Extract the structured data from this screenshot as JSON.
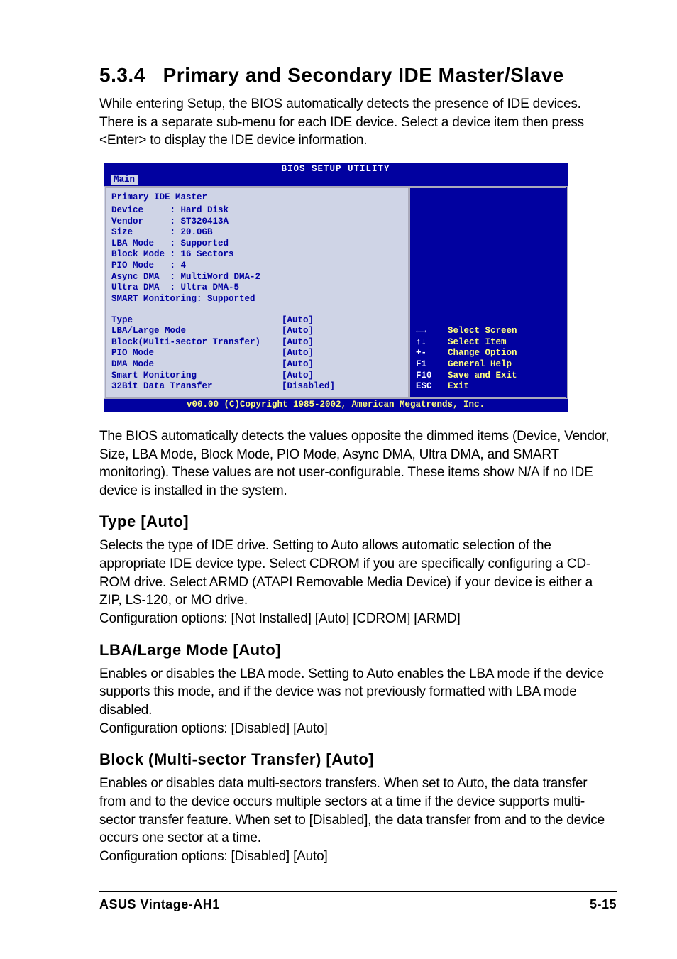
{
  "section": {
    "number": "5.3.4",
    "title": "Primary and Secondary IDE Master/Slave",
    "intro": "While entering Setup, the BIOS automatically detects the presence of IDE devices. There is a separate sub-menu for each IDE device. Select a device item then press <Enter> to display the IDE device information."
  },
  "bios": {
    "title": "BIOS SETUP UTILITY",
    "tab": "Main",
    "heading": "Primary IDE Master",
    "info": [
      {
        "label": "Device",
        "value": "Hard Disk"
      },
      {
        "label": "Vendor",
        "value": "ST320413A"
      },
      {
        "label": "Size",
        "value": "20.0GB"
      },
      {
        "label": "LBA Mode",
        "value": "Supported"
      },
      {
        "label": "Block Mode",
        "value": "16 Sectors"
      },
      {
        "label": "PIO Mode",
        "value": "4"
      },
      {
        "label": "Async DMA",
        "value": "MultiWord DMA-2"
      },
      {
        "label": "Ultra DMA",
        "value": "Ultra DMA-5"
      },
      {
        "label": "SMART Monitoring",
        "value": "Supported"
      }
    ],
    "options": [
      {
        "label": "Type",
        "value": "[Auto]"
      },
      {
        "label": "LBA/Large Mode",
        "value": "[Auto]"
      },
      {
        "label": "Block(Multi-sector Transfer)",
        "value": "[Auto]"
      },
      {
        "label": "PIO Mode",
        "value": "[Auto]"
      },
      {
        "label": "DMA Mode",
        "value": "[Auto]"
      },
      {
        "label": "Smart Monitoring",
        "value": "[Auto]"
      },
      {
        "label": "32Bit Data Transfer",
        "value": "[Disabled]"
      }
    ],
    "nav": [
      {
        "key": "←→",
        "label": "Select Screen"
      },
      {
        "key": "↑↓",
        "label": "Select Item"
      },
      {
        "key": "+-",
        "label": "Change Option"
      },
      {
        "key": "F1",
        "label": "General Help"
      },
      {
        "key": "F10",
        "label": "Save and Exit"
      },
      {
        "key": "ESC",
        "label": "Exit"
      }
    ],
    "footer": "v00.00 (C)Copyright 1985-2002, American Megatrends, Inc."
  },
  "after_bios": "The BIOS automatically detects the values opposite the dimmed items (Device, Vendor, Size, LBA Mode, Block Mode, PIO Mode, Async DMA, Ultra DMA, and SMART monitoring). These values are not user-configurable. These items show N/A if no IDE device is installed in the system.",
  "type_heading": "Type [Auto]",
  "type_body": "Selects the type of IDE drive. Setting to Auto allows automatic selection of the appropriate IDE device type. Select CDROM if you are specifically configuring a CD-ROM drive. Select ARMD (ATAPI Removable Media Device) if your device is either a ZIP, LS-120, or MO drive.\nConfiguration options: [Not Installed] [Auto] [CDROM] [ARMD]",
  "lba_heading": "LBA/Large Mode [Auto]",
  "lba_body": "Enables or disables the LBA mode. Setting to Auto enables the LBA mode if the device supports this mode, and if the device was not previously formatted with LBA mode disabled.\nConfiguration options: [Disabled] [Auto]",
  "block_heading": "Block (Multi-sector Transfer) [Auto]",
  "block_body": "Enables or disables data multi-sectors transfers. When set to Auto, the data transfer from and to the device occurs multiple sectors at a time if the device supports multi-sector transfer feature. When set to [Disabled], the data transfer from and to the device occurs one sector at a time.\nConfiguration options: [Disabled] [Auto]",
  "footer": {
    "left": "ASUS Vintage-AH1",
    "right": "5-15"
  }
}
